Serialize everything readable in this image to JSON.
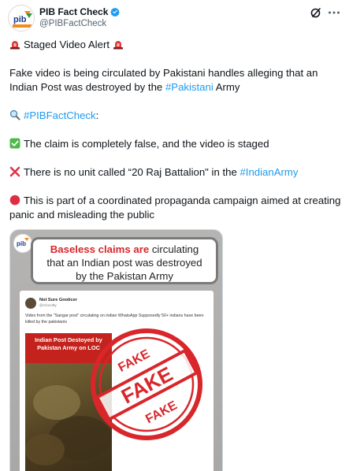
{
  "account": {
    "display_name": "PIB Fact Check",
    "handle": "@PIBFactCheck"
  },
  "tweet": {
    "line1": "Staged Video Alert",
    "line2": "Fake video is being circulated by Pakistani handles alleging that an",
    "line3_pre": "Indian Post was destroyed by  the ",
    "line3_hashtag": "#Pakistani",
    "line3_post": " Army",
    "line4_hashtag": "#PIBFactCheck",
    "line4_post": ":",
    "line5": "The claim is completely false, and the video is staged",
    "line6_pre": "There is no unit called “20 Raj Battalion\" in the ",
    "line6_hashtag": "#IndianArmy",
    "line7": "This is part of a coordinated propaganda campaign aimed at creating panic and misleading the public"
  },
  "media": {
    "banner_red": "Baseless claims are",
    "banner_rest_1": " circulating",
    "banner_line2": "that an Indian post was destroyed",
    "banner_line3": "by the Pakistan Army",
    "inner_name": "Not Sure Gnoticer",
    "inner_handle": "@ViceUtty",
    "inner_text": "Video from the \"Sangar post\" circulating on indian WhatsApp Supposedly 50+ indians have been killed by the pakistanis",
    "video_caption": "Indian Post Destoyed by Pakistan Army on LOC",
    "stamp_word": "FAKE"
  },
  "colors": {
    "link": "#1d9bf0",
    "verified": "#1d9bf0",
    "stamp_red": "#d8262a"
  }
}
